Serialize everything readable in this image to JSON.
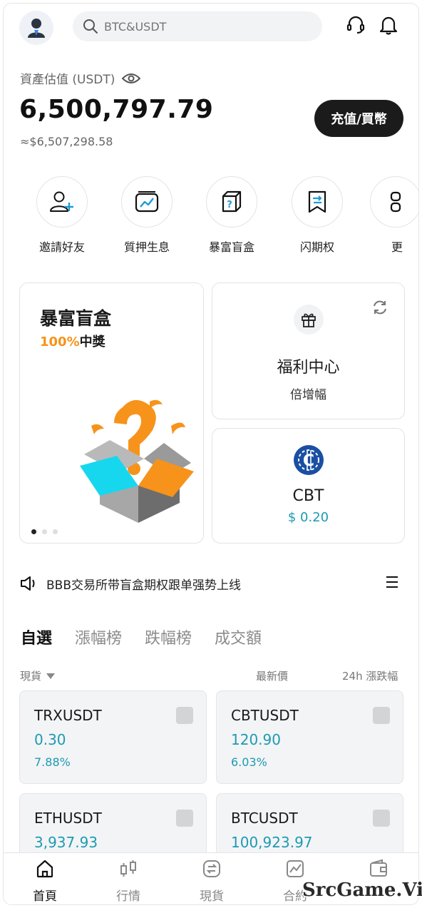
{
  "header": {
    "search_placeholder": "BTC&USDT"
  },
  "asset": {
    "label": "資產估值 (USDT)",
    "value": "6,500,797.79",
    "approx": "≈$6,507,298.58",
    "deposit_label": "充值/買幣"
  },
  "quick_actions": [
    {
      "label": "邀請好友",
      "icon": "add-user-icon"
    },
    {
      "label": "質押生息",
      "icon": "chart-icon"
    },
    {
      "label": "暴富盲盒",
      "icon": "mystery-box-icon"
    },
    {
      "label": "闪期权",
      "icon": "bookmark-arrow-icon"
    },
    {
      "label": "更",
      "icon": "more-icon"
    }
  ],
  "promo": {
    "title": "暴富盲盒",
    "sub_highlight": "100%",
    "sub_rest": "中獎"
  },
  "welfare": {
    "title": "福利中心",
    "subtitle": "倍增幅"
  },
  "cbt": {
    "name": "CBT",
    "price": "$ 0.20"
  },
  "notice": {
    "text": "BBB交易所带盲盒期权跟单强势上线"
  },
  "tabs": [
    "自選",
    "漲幅榜",
    "跌幅榜",
    "成交額"
  ],
  "columns": {
    "filter": "現貨",
    "latest_price": "最新價",
    "change": "24h 漲跌幅"
  },
  "tickers": [
    {
      "name": "TRXUSDT",
      "price": "0.30",
      "change": "7.88%"
    },
    {
      "name": "CBTUSDT",
      "price": "120.90",
      "change": "6.03%"
    },
    {
      "name": "ETHUSDT",
      "price": "3,937.93",
      "change": ""
    },
    {
      "name": "BTCUSDT",
      "price": "100,923.97",
      "change": ""
    }
  ],
  "nav": [
    {
      "label": "首頁"
    },
    {
      "label": "行情"
    },
    {
      "label": "現貨"
    },
    {
      "label": "合約"
    },
    {
      "label": ""
    }
  ],
  "watermark": "SrcGame.Vip",
  "colors": {
    "accent_teal": "#1d9bb2",
    "orange": "#f7931a",
    "dark_button": "#1b1b1b",
    "coin_blue": "#1a4fa3"
  }
}
